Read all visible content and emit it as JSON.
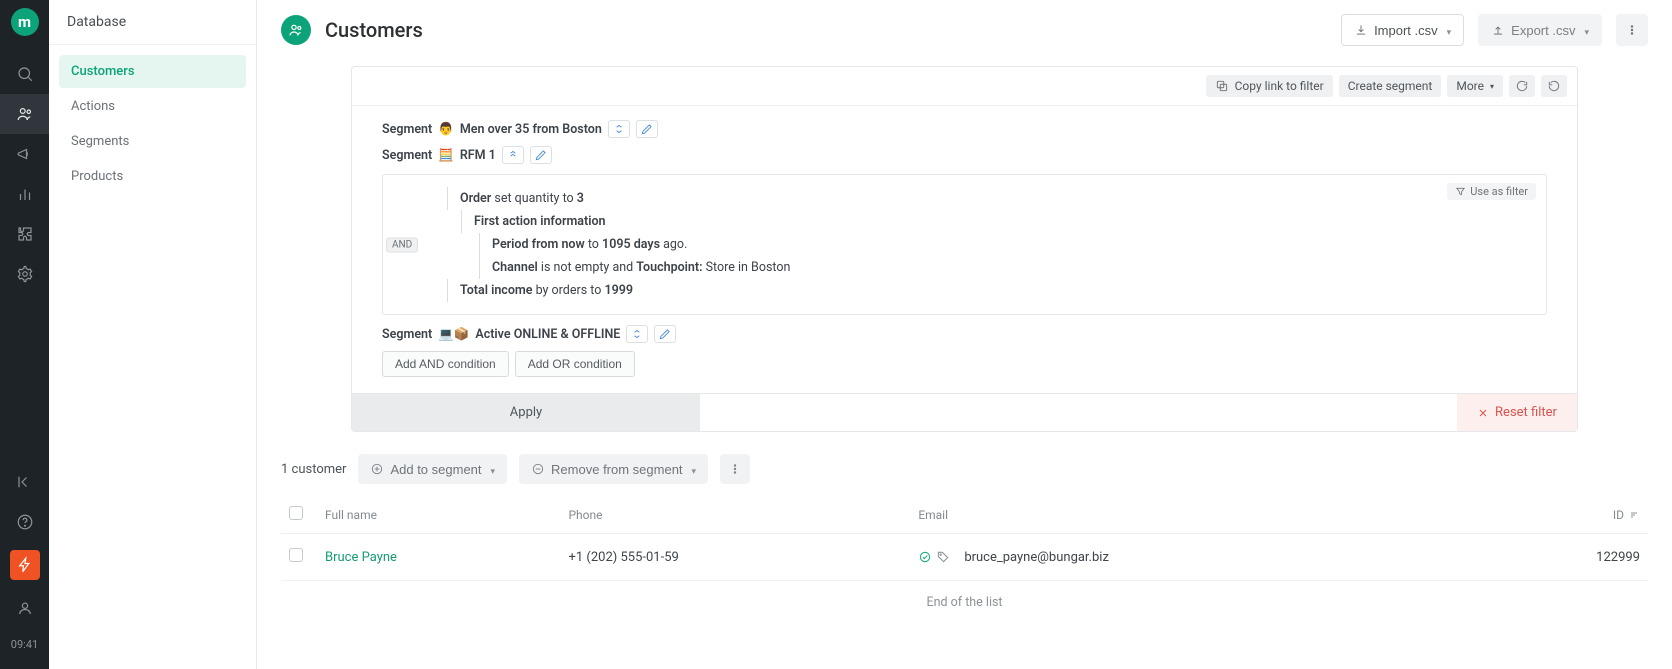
{
  "rail": {
    "time": "09:41"
  },
  "sidebar": {
    "title": "Database",
    "items": [
      "Customers",
      "Actions",
      "Segments",
      "Products"
    ],
    "active_index": 0
  },
  "header": {
    "title": "Customers",
    "import_label": "Import .csv",
    "export_label": "Export .csv"
  },
  "filter_panel": {
    "toolbar": {
      "copy_link": "Copy link to filter",
      "create_segment": "Create segment",
      "more": "More"
    },
    "segments": {
      "seg_a": {
        "prefix": "Segment",
        "emoji": "👨",
        "name": "Men over 35 from Boston"
      },
      "seg_b": {
        "prefix": "Segment",
        "emoji": "🧮",
        "name": "RFM 1",
        "use_as_filter": "Use as filter",
        "and_label": "AND",
        "lines": {
          "order_prefix": "Order",
          "order_mid": " set quantity to ",
          "order_val": "3",
          "first_action": "First action information",
          "period_prefix": "Period from now",
          "period_mid": " to ",
          "period_val": "1095 days",
          "period_suffix": " ago.",
          "channel_prefix": "Channel",
          "channel_mid": " is not empty and ",
          "touchpoint_prefix": "Touchpoint:",
          "touchpoint_val": " Store in Boston",
          "income_prefix": "Total income",
          "income_mid": " by orders to ",
          "income_val": "1999"
        }
      },
      "seg_c": {
        "prefix": "Segment",
        "emoji": "💻📦",
        "name": "Active ONLINE & OFFLINE"
      }
    },
    "add_and": "Add AND condition",
    "add_or": "Add OR condition",
    "apply": "Apply",
    "reset": "Reset filter"
  },
  "results": {
    "count_label": "1 customer",
    "add_to_segment": "Add to segment",
    "remove_from_segment": "Remove from segment",
    "columns": {
      "name": "Full name",
      "phone": "Phone",
      "email": "Email",
      "id": "ID"
    },
    "rows": [
      {
        "name": "Bruce Payne",
        "phone": "+1 (202) 555-01-59",
        "email": "bruce_payne@bungar.biz",
        "id": "122999"
      }
    ],
    "end": "End of the list"
  }
}
